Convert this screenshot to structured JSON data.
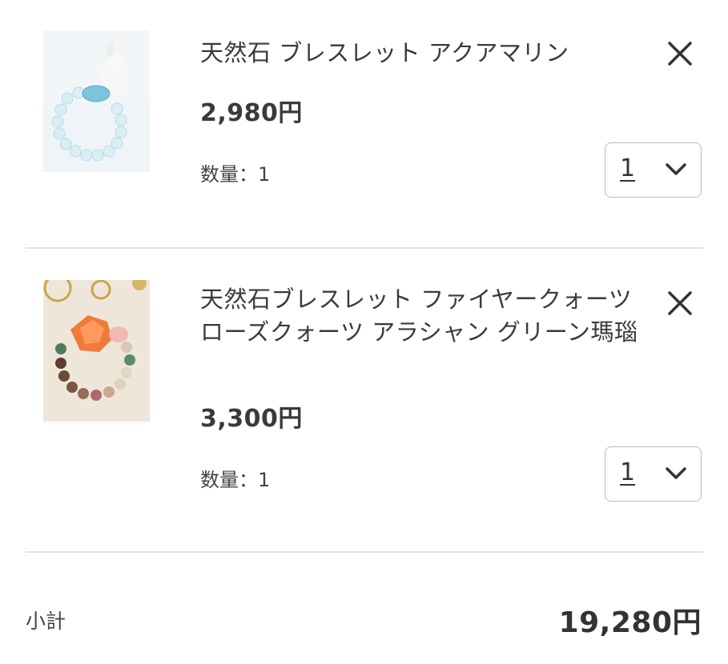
{
  "cart": {
    "items": [
      {
        "name": "天然石 ブレスレット アクアマリン",
        "price": "2,980円",
        "quantity_text": "数量：1",
        "quantity_selected": "1",
        "image_icon": "aquamarine-bracelet-photo",
        "remove_icon": "close-icon",
        "dropdown_icon": "chevron-down-icon"
      },
      {
        "name": "天然石ブレスレット ファイヤークォーツ ローズクォーツ アラシャン グリーン瑪瑙",
        "price": "3,300円",
        "quantity_text": "数量：1",
        "quantity_selected": "1",
        "image_icon": "fire-quartz-bracelet-photo",
        "remove_icon": "close-icon",
        "dropdown_icon": "chevron-down-icon"
      }
    ],
    "subtotal_label": "小計",
    "subtotal_value": "19,280円"
  },
  "colors": {
    "text": "#333333",
    "divider": "#e2e2e2",
    "select_border": "#bdbdbd",
    "background": "#ffffff"
  }
}
